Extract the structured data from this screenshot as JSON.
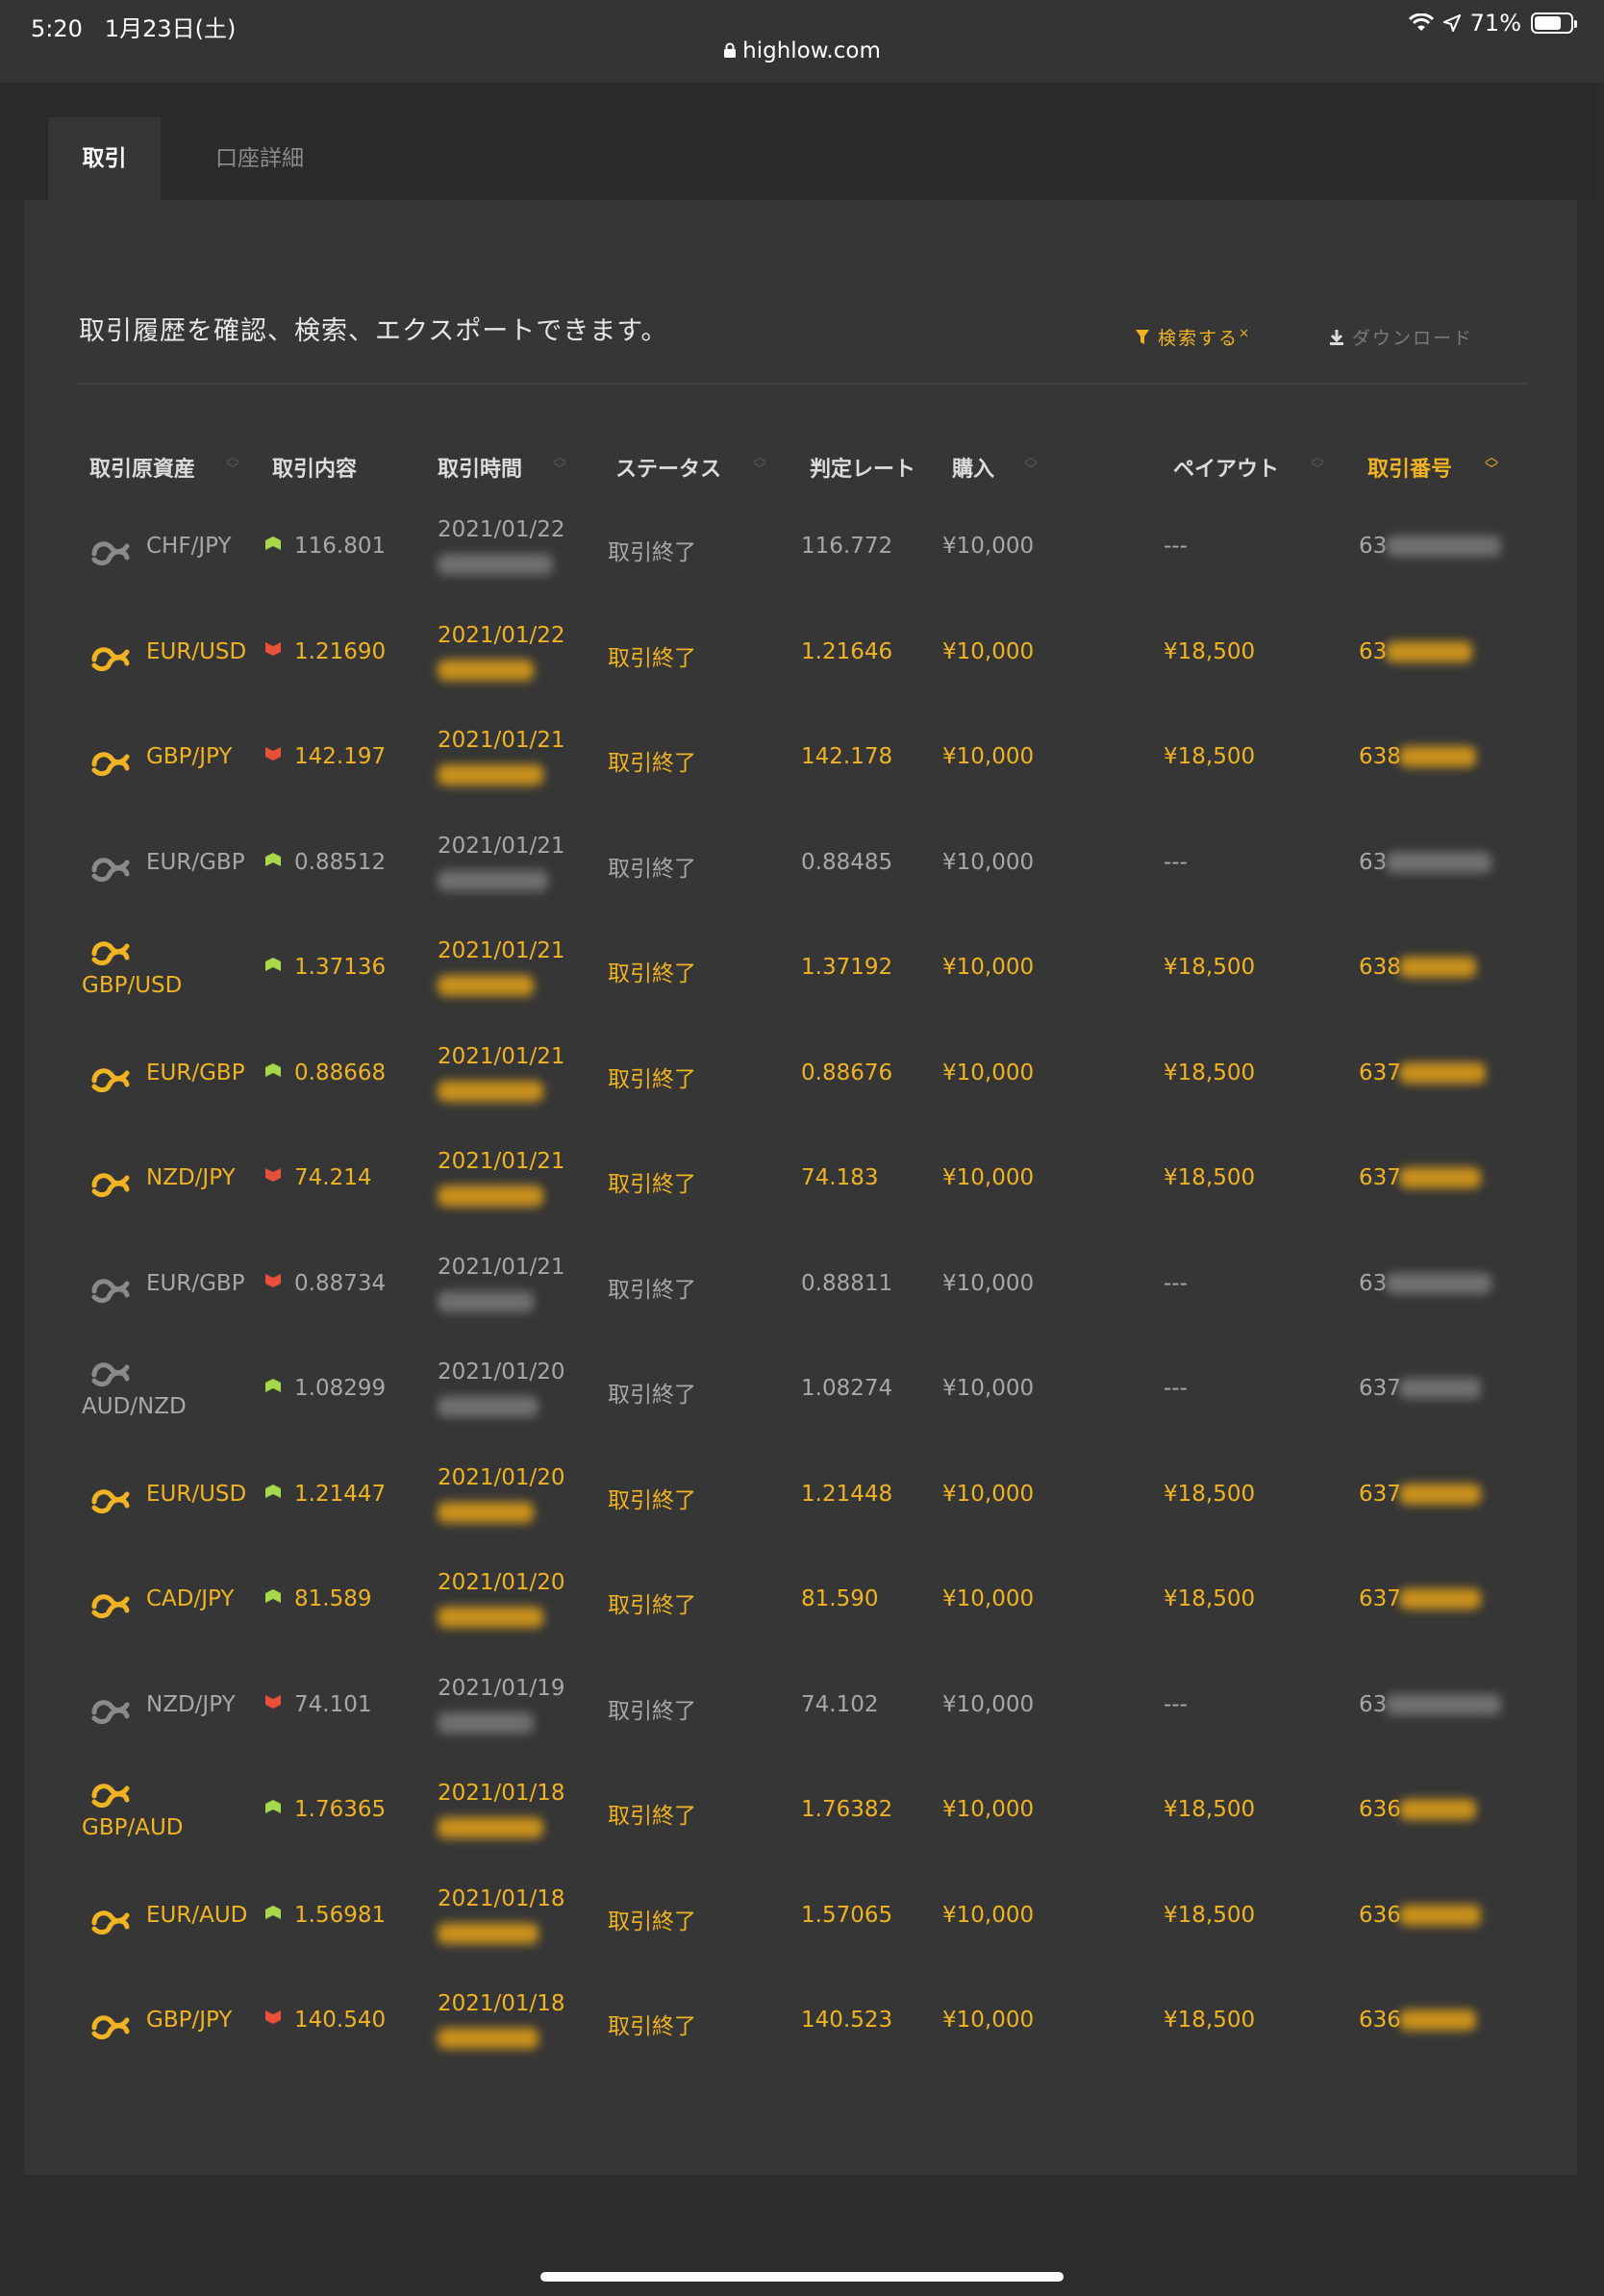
{
  "status_bar": {
    "time": "5:20",
    "date": "1月23日(土)",
    "battery_percent": "71%",
    "url": "highlow.com"
  },
  "tabs": [
    {
      "label": "取引",
      "active": true
    },
    {
      "label": "口座詳細",
      "active": false
    }
  ],
  "intro_text": "取引履歴を確認、検索、エクスポートできます。",
  "toolbar": {
    "search_label": "検索する",
    "download_label": "ダウンロード"
  },
  "columns": [
    "取引原資産",
    "取引内容",
    "取引時間",
    "ステータス",
    "判定レート",
    "購入",
    "ペイアウト",
    "取引番号"
  ],
  "rows": [
    {
      "asset": "CHF/JPY",
      "direction": "up",
      "rate": "116.801",
      "date": "2021/01/22",
      "status": "取引終了",
      "judge": "116.772",
      "purchase": "¥10,000",
      "payout": "---",
      "id": "63",
      "win": false
    },
    {
      "asset": "EUR/USD",
      "direction": "down",
      "rate": "1.21690",
      "date": "2021/01/22",
      "status": "取引終了",
      "judge": "1.21646",
      "purchase": "¥10,000",
      "payout": "¥18,500",
      "id": "63",
      "win": true
    },
    {
      "asset": "GBP/JPY",
      "direction": "down",
      "rate": "142.197",
      "date": "2021/01/21",
      "status": "取引終了",
      "judge": "142.178",
      "purchase": "¥10,000",
      "payout": "¥18,500",
      "id": "638",
      "win": true
    },
    {
      "asset": "EUR/GBP",
      "direction": "up",
      "rate": "0.88512",
      "date": "2021/01/21",
      "status": "取引終了",
      "judge": "0.88485",
      "purchase": "¥10,000",
      "payout": "---",
      "id": "63",
      "win": false
    },
    {
      "asset": "GBP/USD",
      "direction": "up",
      "rate": "1.37136",
      "date": "2021/01/21",
      "status": "取引終了",
      "judge": "1.37192",
      "purchase": "¥10,000",
      "payout": "¥18,500",
      "id": "638",
      "win": true,
      "wrap": true
    },
    {
      "asset": "EUR/GBP",
      "direction": "up",
      "rate": "0.88668",
      "date": "2021/01/21",
      "status": "取引終了",
      "judge": "0.88676",
      "purchase": "¥10,000",
      "payout": "¥18,500",
      "id": "637",
      "win": true
    },
    {
      "asset": "NZD/JPY",
      "direction": "down",
      "rate": "74.214",
      "date": "2021/01/21",
      "status": "取引終了",
      "judge": "74.183",
      "purchase": "¥10,000",
      "payout": "¥18,500",
      "id": "637",
      "win": true
    },
    {
      "asset": "EUR/GBP",
      "direction": "down",
      "rate": "0.88734",
      "date": "2021/01/21",
      "status": "取引終了",
      "judge": "0.88811",
      "purchase": "¥10,000",
      "payout": "---",
      "id": "63",
      "win": false
    },
    {
      "asset": "AUD/NZD",
      "direction": "up",
      "rate": "1.08299",
      "date": "2021/01/20",
      "status": "取引終了",
      "judge": "1.08274",
      "purchase": "¥10,000",
      "payout": "---",
      "id": "637",
      "win": false,
      "wrap": true
    },
    {
      "asset": "EUR/USD",
      "direction": "up",
      "rate": "1.21447",
      "date": "2021/01/20",
      "status": "取引終了",
      "judge": "1.21448",
      "purchase": "¥10,000",
      "payout": "¥18,500",
      "id": "637",
      "win": true
    },
    {
      "asset": "CAD/JPY",
      "direction": "up",
      "rate": "81.589",
      "date": "2021/01/20",
      "status": "取引終了",
      "judge": "81.590",
      "purchase": "¥10,000",
      "payout": "¥18,500",
      "id": "637",
      "win": true
    },
    {
      "asset": "NZD/JPY",
      "direction": "down",
      "rate": "74.101",
      "date": "2021/01/19",
      "status": "取引終了",
      "judge": "74.102",
      "purchase": "¥10,000",
      "payout": "---",
      "id": "63",
      "win": false
    },
    {
      "asset": "GBP/AUD",
      "direction": "up",
      "rate": "1.76365",
      "date": "2021/01/18",
      "status": "取引終了",
      "judge": "1.76382",
      "purchase": "¥10,000",
      "payout": "¥18,500",
      "id": "636",
      "win": true,
      "wrap": true
    },
    {
      "asset": "EUR/AUD",
      "direction": "up",
      "rate": "1.56981",
      "date": "2021/01/18",
      "status": "取引終了",
      "judge": "1.57065",
      "purchase": "¥10,000",
      "payout": "¥18,500",
      "id": "636",
      "win": true
    },
    {
      "asset": "GBP/JPY",
      "direction": "down",
      "rate": "140.540",
      "date": "2021/01/18",
      "status": "取引終了",
      "judge": "140.523",
      "purchase": "¥10,000",
      "payout": "¥18,500",
      "id": "636",
      "win": true
    }
  ],
  "colors": {
    "accent": "#f0b323",
    "up": "#a6d84a",
    "down": "#e8503a",
    "background": "#2c2c2c",
    "panel": "#363636"
  }
}
